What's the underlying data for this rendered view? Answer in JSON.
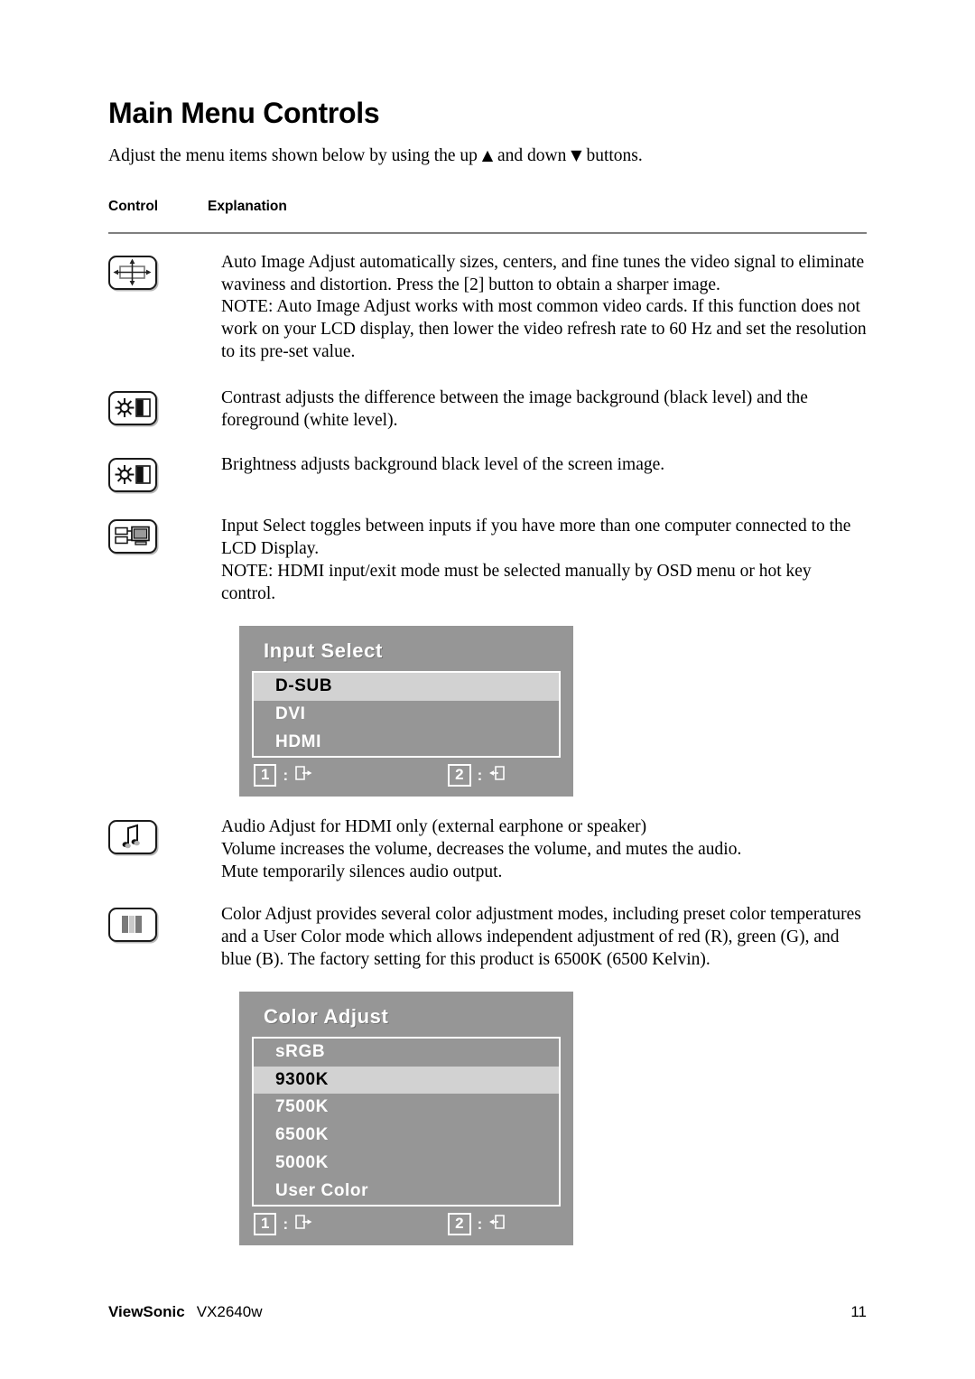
{
  "document": {
    "title": "Main Menu Controls",
    "intro_before": "Adjust the menu items shown below by using the up ",
    "intro_up_symbol": "▲",
    "intro_middle": " and down ",
    "intro_down_symbol": "▼",
    "intro_after": " buttons."
  },
  "table": {
    "header": {
      "control": "Control",
      "explanation": "Explanation"
    },
    "rows": [
      {
        "icon": "auto-image-adjust-icon",
        "lines": [
          "Auto Image Adjust automatically sizes, centers, and fine tunes the video signal to eliminate waviness and distortion. Press the [2] button to obtain a sharper image.",
          "NOTE: Auto Image Adjust works with most common video cards. If this function does not work on your LCD display, then lower the video refresh rate to 60 Hz and set the resolution to its pre-set value."
        ]
      },
      {
        "icon": "contrast-icon",
        "lines": [
          "Contrast adjusts the difference between the image background  (black level) and the foreground (white level)."
        ]
      },
      {
        "icon": "brightness-icon",
        "lines": [
          "Brightness adjusts background black level of the screen image."
        ]
      },
      {
        "icon": "input-select-icon",
        "lines": [
          "Input Select toggles between inputs if you have more than one computer connected to the LCD Display.",
          "NOTE: HDMI input/exit mode must be selected manually by OSD menu or hot key control."
        ]
      },
      {
        "icon": "audio-adjust-icon",
        "lines": [
          "Audio Adjust for HDMI only (external earphone or speaker)",
          "Volume increases the volume, decreases the volume, and mutes the audio.",
          "Mute temporarily silences audio output."
        ]
      },
      {
        "icon": "color-adjust-icon",
        "lines": [
          "Color Adjust provides several color adjustment modes, including preset color temperatures and a User Color mode which allows independent adjustment of red (R), green (G), and blue (B). The factory setting for this product is 6500K (6500 Kelvin)."
        ]
      }
    ]
  },
  "osd_input_select": {
    "title": "Input Select",
    "items": [
      {
        "label": "D-SUB",
        "selected": true
      },
      {
        "label": "DVI",
        "selected": false
      },
      {
        "label": "HDMI",
        "selected": false
      }
    ],
    "footer": {
      "key1": "1",
      "key2": "2",
      "colon": ":",
      "icon1": "exit-menu-icon",
      "icon2": "enter-menu-icon"
    }
  },
  "osd_color_adjust": {
    "title": "Color Adjust",
    "items": [
      {
        "label": "sRGB",
        "selected": false
      },
      {
        "label": "9300K",
        "selected": true
      },
      {
        "label": "7500K",
        "selected": false
      },
      {
        "label": "6500K",
        "selected": false
      },
      {
        "label": "5000K",
        "selected": false
      },
      {
        "label": "User Color",
        "selected": false
      }
    ],
    "footer": {
      "key1": "1",
      "key2": "2",
      "colon": ":",
      "icon1": "exit-menu-icon",
      "icon2": "enter-menu-icon"
    }
  },
  "footer": {
    "brand": "ViewSonic",
    "model": "VX2640w",
    "page_number": "11"
  },
  "colors": {
    "osd_background": "#969696",
    "osd_selected_row": "#d2d2d2",
    "osd_text": "#ffffff",
    "osd_selected_text": "#000000",
    "rule": "#808080"
  }
}
